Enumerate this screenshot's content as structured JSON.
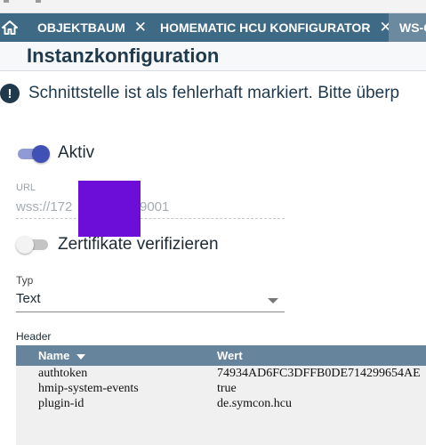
{
  "tabs": [
    {
      "label": "OBJEKTBAUM"
    },
    {
      "label": "HOMEMATIC HCU KONFIGURATOR"
    },
    {
      "label": "WS-C"
    }
  ],
  "page_title": "Instanzkonfiguration",
  "alert": {
    "text": "Schnittstelle ist als fehlerhaft markiert. Bitte überp"
  },
  "form": {
    "aktiv": {
      "label": "Aktiv",
      "checked": true
    },
    "url": {
      "label": "URL",
      "value": "wss://172",
      "value_suffix": "9001"
    },
    "zertifikate": {
      "label": "Zertifikate verifizieren",
      "checked": false
    },
    "typ": {
      "label": "Typ",
      "value": "Text"
    }
  },
  "header_table": {
    "label": "Header",
    "columns": [
      "Name",
      "Wert"
    ],
    "rows": [
      {
        "name": "authtoken",
        "value": "74934AD6FC3DFFB0DE714299654AE"
      },
      {
        "name": "hmip-system-events",
        "value": "true"
      },
      {
        "name": "plugin-id",
        "value": "de.symcon.hcu"
      }
    ]
  },
  "colors": {
    "tabbar": "#3f6a85",
    "switch_on": "#3f51b5",
    "table_header": "#66849b",
    "redaction": "#6c0ed8"
  }
}
